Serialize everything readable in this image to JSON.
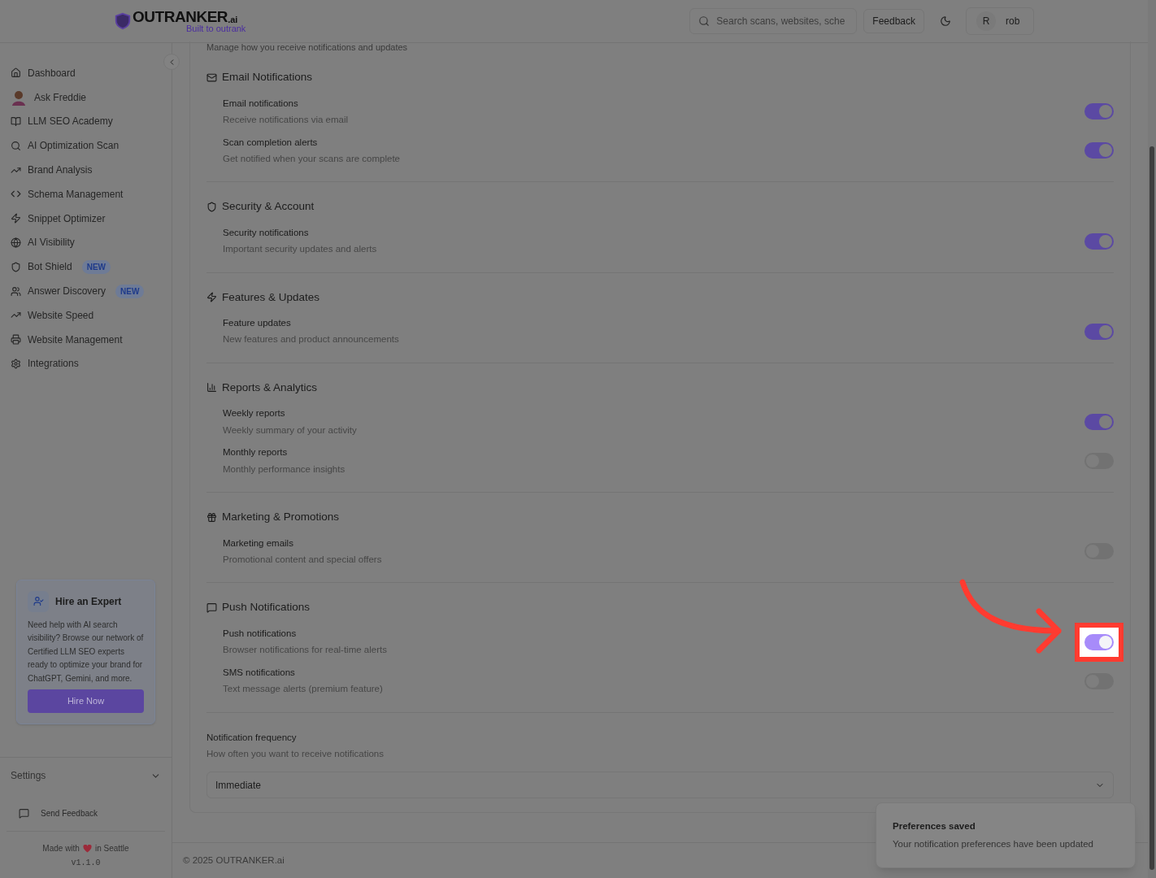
{
  "header": {
    "logo": {
      "name": "OUTRANKER",
      "suffix": ".ai",
      "tagline": "Built to outrank"
    },
    "search": {
      "placeholder": "Search scans, websites, sche"
    },
    "feedback_button": "Feedback",
    "user": {
      "initial": "R",
      "name": "rob"
    }
  },
  "sidebar": {
    "items": [
      {
        "label": "Dashboard"
      },
      {
        "label": "Ask Freddie"
      },
      {
        "label": "LLM SEO Academy"
      },
      {
        "label": "AI Optimization Scan"
      },
      {
        "label": "Brand Analysis"
      },
      {
        "label": "Schema Management"
      },
      {
        "label": "Snippet Optimizer"
      },
      {
        "label": "AI Visibility"
      },
      {
        "label": "Bot Shield",
        "badge": "NEW"
      },
      {
        "label": "Answer Discovery",
        "badge": "NEW"
      },
      {
        "label": "Website Speed"
      },
      {
        "label": "Website Management"
      },
      {
        "label": "Integrations"
      }
    ],
    "promo": {
      "title": "Hire an Expert",
      "text": "Need help with AI search visibility? Browse our network of Certified LLM SEO experts ready to optimize your brand for ChatGPT, Gemini, and more.",
      "button": "Hire Now"
    },
    "settings": {
      "label": "Settings",
      "expanded": false
    },
    "send_feedback": "Send Feedback",
    "made_with": {
      "before": "Made with",
      "after": "in Seattle"
    },
    "version": "v1.1.0"
  },
  "page": {
    "subtitle": "Manage how you receive notifications and updates",
    "sections": [
      {
        "title": "Email Notifications",
        "items": [
          {
            "label": "Email notifications",
            "description": "Receive notifications via email",
            "on": true,
            "highlighted": false
          },
          {
            "label": "Scan completion alerts",
            "description": "Get notified when your scans are complete",
            "on": true,
            "highlighted": false
          }
        ]
      },
      {
        "title": "Security & Account",
        "items": [
          {
            "label": "Security notifications",
            "description": "Important security updates and alerts",
            "on": true,
            "highlighted": false
          }
        ]
      },
      {
        "title": "Features & Updates",
        "items": [
          {
            "label": "Feature updates",
            "description": "New features and product announcements",
            "on": true,
            "highlighted": false
          }
        ]
      },
      {
        "title": "Reports & Analytics",
        "items": [
          {
            "label": "Weekly reports",
            "description": "Weekly summary of your activity",
            "on": true,
            "highlighted": false
          },
          {
            "label": "Monthly reports",
            "description": "Monthly performance insights",
            "on": false,
            "highlighted": false
          }
        ]
      },
      {
        "title": "Marketing & Promotions",
        "items": [
          {
            "label": "Marketing emails",
            "description": "Promotional content and special offers",
            "on": false,
            "highlighted": false
          }
        ]
      },
      {
        "title": "Push Notifications",
        "items": [
          {
            "label": "Push notifications",
            "description": "Browser notifications for real-time alerts",
            "on": true,
            "highlighted": true
          },
          {
            "label": "SMS notifications",
            "description": "Text message alerts (premium feature)",
            "on": false,
            "highlighted": false
          }
        ]
      }
    ],
    "frequency": {
      "label": "Notification frequency",
      "description": "How often you want to receive notifications",
      "value": "Immediate"
    }
  },
  "footer": "© 2025 OUTRANKER.ai",
  "toast": {
    "title": "Preferences saved",
    "message": "Your notification preferences have been updated"
  }
}
